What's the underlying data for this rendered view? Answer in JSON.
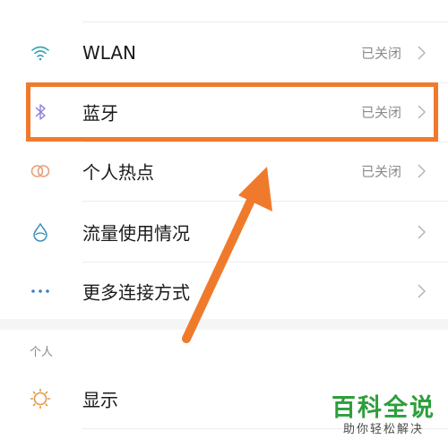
{
  "rows": [
    {
      "id": "wlan",
      "icon": "wifi-icon",
      "label": "WLAN",
      "status": "已关闭"
    },
    {
      "id": "bluetooth",
      "icon": "bluetooth-icon",
      "label": "蓝牙",
      "status": "已关闭"
    },
    {
      "id": "hotspot",
      "icon": "hotspot-icon",
      "label": "个人热点",
      "status": "已关闭"
    },
    {
      "id": "data-usage",
      "icon": "water-drop-icon",
      "label": "流量使用情况",
      "status": ""
    },
    {
      "id": "more-connections",
      "icon": "more-dots-icon",
      "label": "更多连接方式",
      "status": ""
    },
    {
      "id": "display",
      "icon": "sun-icon",
      "label": "显示",
      "status": ""
    }
  ],
  "section": {
    "title": "个人"
  },
  "watermark": {
    "main": "百科全说",
    "sub": "助你轻松解决"
  },
  "colors": {
    "highlight": "#f07a2c",
    "wifi": "#3aa7b0",
    "bluetooth": "#8a7fd6",
    "hotspot": "#e8a07a",
    "drop": "#3a8fb8",
    "dots": "#3a7fc4",
    "sun": "#e29a4a",
    "watermark_main": "#2e9e3c"
  }
}
